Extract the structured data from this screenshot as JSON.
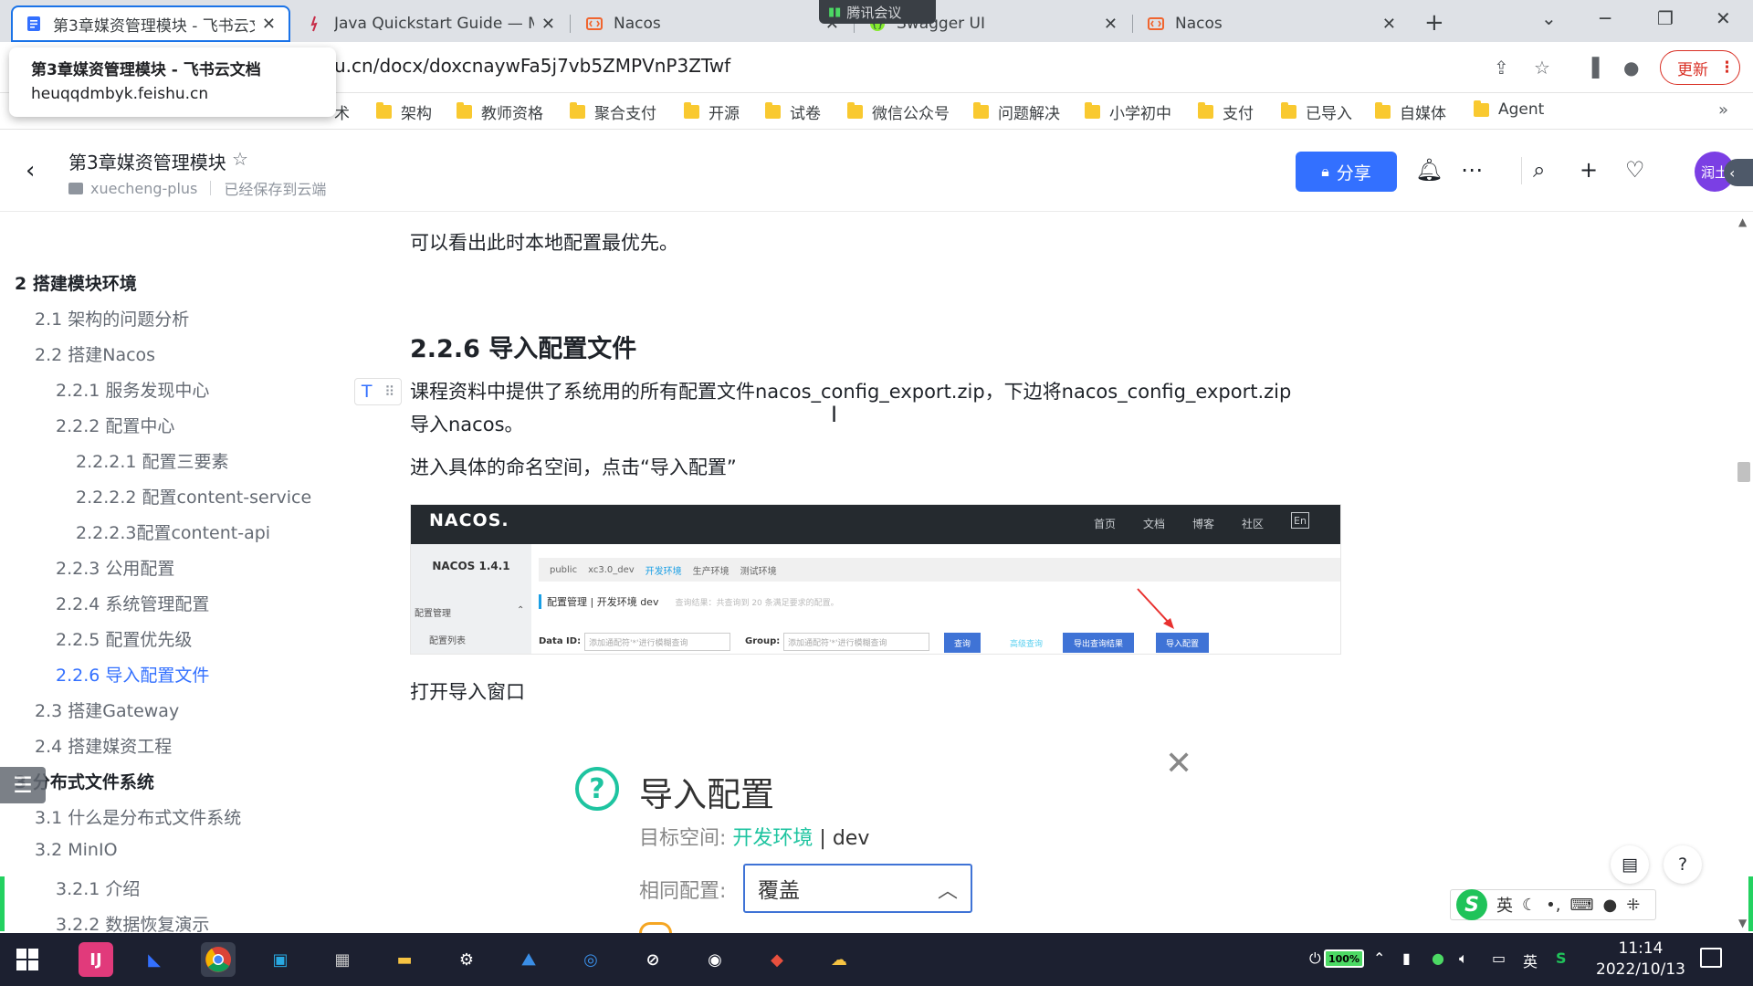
{
  "browser": {
    "tabs": [
      {
        "title": "第3章媒资管理模块 - 飞书云文档",
        "active": true
      },
      {
        "title": "Java Quickstart Guide — MinIO",
        "active": false
      },
      {
        "title": "Nacos",
        "active": false
      },
      {
        "title": "Swagger UI",
        "active": false
      },
      {
        "title": "Nacos",
        "active": false
      }
    ],
    "meeting_label": "腾讯会议",
    "url": "u.cn/docx/doxcnaywFa5j7vb5ZMPVnP3ZTwf",
    "update_label": "更新",
    "tooltip": {
      "title": "第3章媒资管理模块 - 飞书云文档",
      "domain": "heuqqdmbyk.feishu.cn"
    },
    "bookmarks": [
      "术",
      "架构",
      "教师资格",
      "聚合支付",
      "开源",
      "试卷",
      "微信公众号",
      "问题解决",
      "小学初中",
      "支付",
      "已导入",
      "自媒体",
      "Agent"
    ],
    "bookmark_more": "»"
  },
  "doc_header": {
    "title": "第3章媒资管理模块",
    "space": "xuecheng-plus",
    "save_status": "已经保存到云端",
    "share_label": "分享",
    "avatar_text": "润土"
  },
  "outline": [
    {
      "text": "2 搭建模块环境",
      "level": 1
    },
    {
      "text": "2.1 架构的问题分析",
      "level": 2
    },
    {
      "text": "2.2 搭建Nacos",
      "level": 2
    },
    {
      "text": "2.2.1 服务发现中心",
      "level": 3
    },
    {
      "text": "2.2.2 配置中心",
      "level": 3
    },
    {
      "text": "2.2.2.1 配置三要素",
      "level": 4
    },
    {
      "text": "2.2.2.2 配置content-service",
      "level": 4
    },
    {
      "text": "2.2.2.3配置content-api",
      "level": 4
    },
    {
      "text": "2.2.3 公用配置",
      "level": 3
    },
    {
      "text": "2.2.4 系统管理配置",
      "level": 3
    },
    {
      "text": "2.2.5 配置优先级",
      "level": 3
    },
    {
      "text": "2.2.6 导入配置文件",
      "level": 3,
      "active": true
    },
    {
      "text": "2.3 搭建Gateway",
      "level": 2
    },
    {
      "text": "2.4 搭建媒资工程",
      "level": 2
    },
    {
      "text": "3 分布式文件系统",
      "level": 1
    },
    {
      "text": "3.1 什么是分布式文件系统",
      "level": 2
    },
    {
      "text": "3.2 MinIO",
      "level": 2
    },
    {
      "text": "3.2.1 介绍",
      "level": 3
    },
    {
      "text": "3.2.2 数据恢复演示",
      "level": 3
    }
  ],
  "doc": {
    "p_top": "可以看出此时本地配置最优先。",
    "heading": "2.2.6 导入配置文件",
    "p1_line1": "课程资料中提供了系统用的所有配置文件nacos_config_export.zip，下边将nacos_config_export.zip",
    "p1_line2": "导入nacos。",
    "p2": "进入具体的命名空间，点击“导入配置”",
    "p3": "打开导入窗口"
  },
  "nacos_shot": {
    "logo": "NACOS.",
    "nav": [
      "首页",
      "文档",
      "博客",
      "社区"
    ],
    "lang": "En",
    "version": "NACOS 1.4.1",
    "side_menu": "配置管理",
    "side_sub": "配置列表",
    "namespaces": [
      "public",
      "xc3.0_dev",
      "开发环境",
      "生产环境",
      "测试环境"
    ],
    "cfg_title": "配置管理 | 开发环境 dev",
    "cfg_hint": "查询结果：共查询到 20 条满足要求的配置。",
    "dataid_label": "Data ID:",
    "dataid_placeholder": "添加通配符'*'进行模糊查询",
    "group_label": "Group:",
    "group_placeholder": "添加通配符'*'进行模糊查询",
    "query_btn": "查询",
    "adv_query": "高级查询",
    "export_btn": "导出查询结果",
    "import_btn": "导入配置"
  },
  "import_dialog": {
    "title": "导入配置",
    "target_label": "目标空间:",
    "target_env": "开发环境",
    "target_sep": " | ",
    "target_ns": "dev",
    "same_label": "相同配置:",
    "same_value": "覆盖"
  },
  "ime": {
    "lang": "英"
  },
  "taskbar": {
    "battery": "100%",
    "ime_lang": "英",
    "time": "11:14",
    "date": "2022/10/13"
  }
}
